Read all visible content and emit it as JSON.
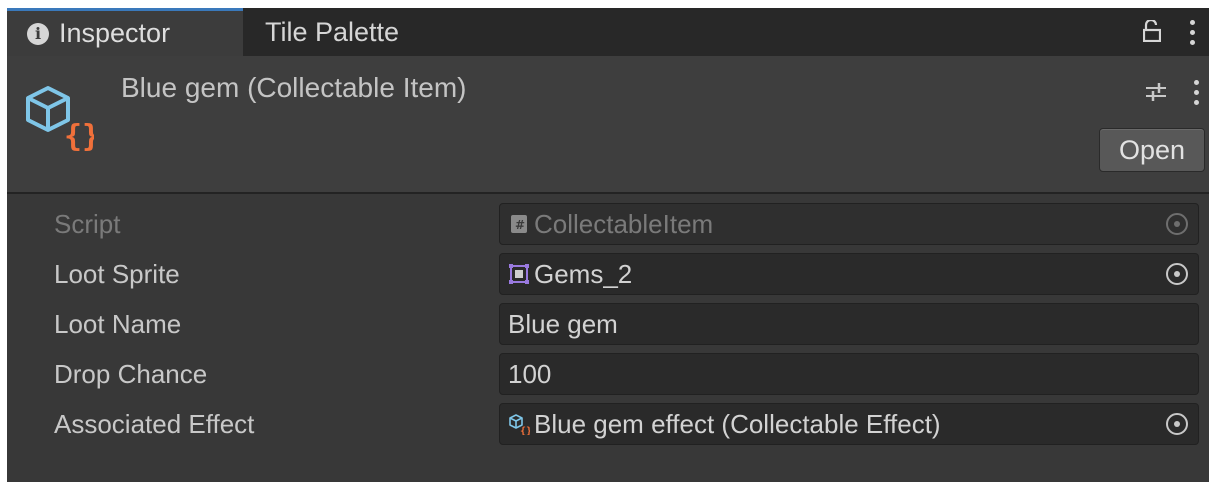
{
  "tabs": {
    "inspector": "Inspector",
    "tile_palette": "Tile Palette"
  },
  "header": {
    "title": "Blue gem (Collectable Item)",
    "open_label": "Open"
  },
  "fields": [
    {
      "label": "Script",
      "value": "CollectableItem",
      "icon": "script-icon",
      "disabled": true
    },
    {
      "label": "Loot Sprite",
      "value": "Gems_2",
      "icon": "sprite-icon"
    },
    {
      "label": "Loot Name",
      "value": "Blue gem"
    },
    {
      "label": "Drop Chance",
      "value": "100"
    },
    {
      "label": "Associated Effect",
      "value": "Blue gem effect (Collectable Effect)",
      "icon": "scriptable-object-icon"
    }
  ],
  "colors": {
    "accent": "#3a79bb",
    "cube_blue": "#7fc6e8",
    "brace_orange": "#f0703a",
    "sprite_purple": "#9a7ae0"
  }
}
